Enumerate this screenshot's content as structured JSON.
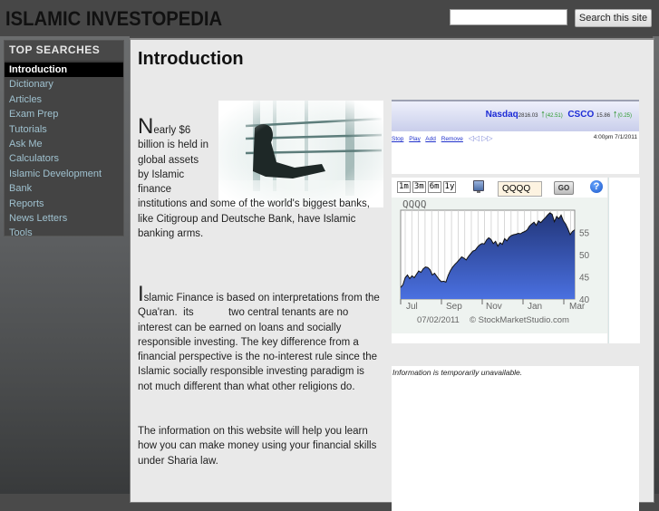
{
  "header": {
    "site_title": "ISLAMIC INVESTOPEDIA",
    "search_value": "",
    "search_button": "Search this site"
  },
  "sidebar": {
    "title": "TOP SEARCHES",
    "items": [
      {
        "label": "Introduction",
        "active": true
      },
      {
        "label": "Dictionary"
      },
      {
        "label": "Articles"
      },
      {
        "label": "Exam Prep"
      },
      {
        "label": "Tutorials"
      },
      {
        "label": "Ask Me"
      },
      {
        "label": "Calculators"
      },
      {
        "label": "Islamic Development Bank"
      },
      {
        "label": "Reports"
      },
      {
        "label": "News Letters"
      },
      {
        "label": "Tools"
      }
    ]
  },
  "main": {
    "title": "Introduction",
    "p1_drop": "N",
    "p1_lead": "early $6 billion is held in global assets by Islamic finance",
    "p1_rest": "institutions and some of the world's biggest banks, like Citigroup and Deutsche Bank, have Islamic banking arms.",
    "p2_drop": "I",
    "p2_text": "slamic Finance is based on interpretations from the Qua'ran.  its            two central tenants are no interest can be earned on loans and socially responsible investing. The key difference from a financial perspective is the no-interest rule since the Islamic socially responsible investing paradigm is not much different than what other religions do.",
    "p3_text": "The information on this website will help you learn how you can make money using your financial skills under Sharia law."
  },
  "ticker": {
    "items": [
      {
        "symbol": "Nasdaq",
        "price": "2816.03",
        "change": "(42.51)",
        "direction": "up"
      },
      {
        "symbol": "CSCO",
        "price": "15.86",
        "change": "(0.25)",
        "direction": "up"
      }
    ],
    "links": [
      "Stop",
      "Play",
      "Add",
      "Remove"
    ],
    "nav_arrows": "◁◁ ▷▷",
    "timestamp": "4:00pm 7/1/2011"
  },
  "stock_widget": {
    "ranges": [
      "1m",
      "3m",
      "6m",
      "1y"
    ],
    "symbol_value": "QQQQ",
    "go_label": "GO",
    "help_label": "?",
    "footer_date": "07/02/2011",
    "footer_credit": "© StockMarketStudio.com",
    "colors": {
      "fill_top": "#22367a",
      "fill_bottom": "#4a70e0",
      "line": "#111111"
    }
  },
  "info_box": {
    "text": "Information is temporarily unavailable."
  },
  "chart_data": {
    "type": "area",
    "title": "QQQQ",
    "xlabel": "",
    "ylabel": "",
    "x_tick_labels": [
      "Jul",
      "Sep",
      "Nov",
      "Jan",
      "Mar"
    ],
    "y_tick_labels": [
      "40",
      "45",
      "50",
      "55"
    ],
    "ylim": [
      40,
      60
    ],
    "grid": "vertical",
    "series": [
      {
        "name": "QQQQ",
        "values": [
          42.6,
          43.2,
          44.8,
          45.4,
          44.6,
          45.2,
          44.8,
          45.6,
          46.3,
          46.0,
          46.8,
          47.2,
          47.1,
          46.6,
          45.4,
          45.8,
          45.1,
          44.4,
          43.9,
          44.0,
          43.8,
          45.3,
          46.4,
          47.2,
          47.8,
          48.3,
          48.9,
          49.5,
          49.2,
          48.8,
          49.6,
          50.2,
          50.8,
          51.0,
          51.7,
          52.2,
          52.5,
          52.4,
          53.3,
          53.8,
          53.4,
          52.5,
          53.0,
          51.9,
          52.7,
          52.3,
          53.6,
          53.1,
          53.9,
          54.3,
          54.5,
          54.6,
          54.8,
          54.7,
          55.0,
          55.2,
          55.6,
          56.4,
          56.9,
          57.3,
          56.6,
          57.6,
          57.2,
          57.8,
          58.3,
          58.9,
          59.4,
          59.1,
          57.4,
          58.6,
          58.1,
          58.9,
          57.6,
          56.9,
          55.8,
          54.5,
          55.2,
          55.6
        ]
      }
    ]
  }
}
